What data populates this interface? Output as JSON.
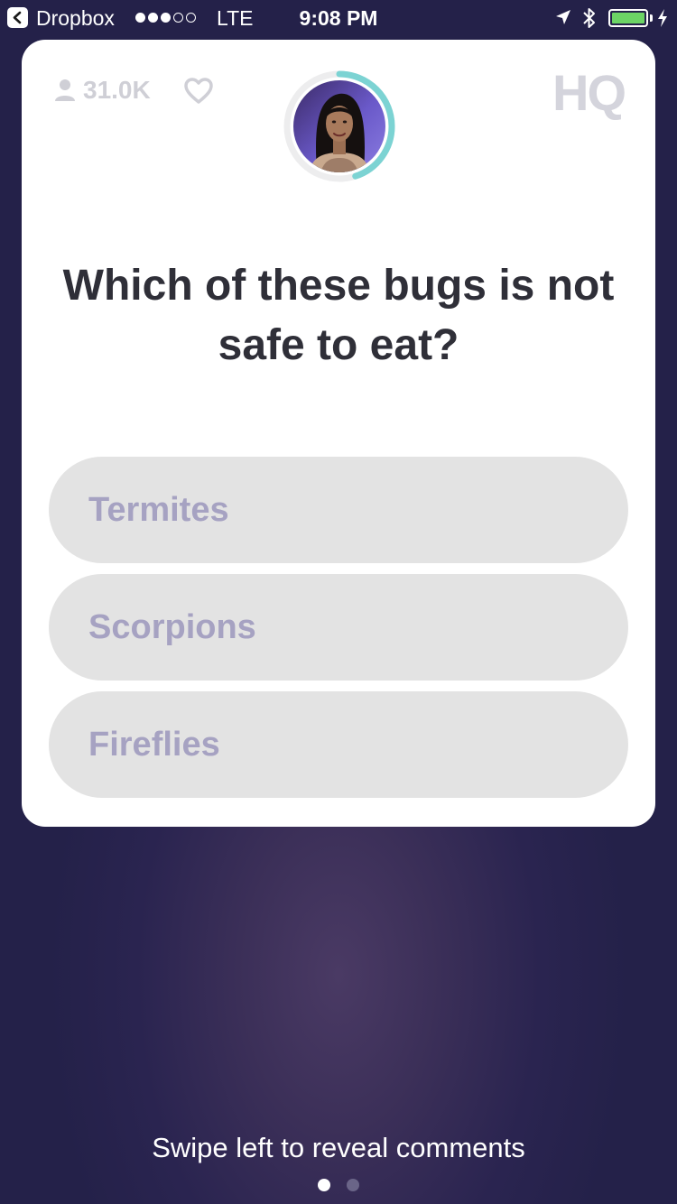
{
  "status_bar": {
    "back_app": "Dropbox",
    "carrier": "LTE",
    "time": "9:08 PM",
    "signal_bars_on": 3,
    "signal_bars_total": 5,
    "battery_level": 1.0,
    "battery_color": "#6cd465"
  },
  "card": {
    "viewer_count": "31.0K",
    "logo_text": "HQ",
    "host_timer_progress": 0.45,
    "timer_ring_color": "#7cd3d3",
    "question": "Which of these bugs is not safe to eat?",
    "answers": [
      "Termites",
      "Scorpions",
      "Fireflies"
    ]
  },
  "footer": {
    "swipe_hint": "Swipe left to reveal comments",
    "page_index": 0,
    "page_count": 2
  },
  "icons": {
    "back": "back-chevron-icon",
    "location": "location-arrow-icon",
    "bluetooth": "bluetooth-icon",
    "charging": "charging-bolt-icon",
    "viewers": "person-icon",
    "like": "heart-icon"
  }
}
